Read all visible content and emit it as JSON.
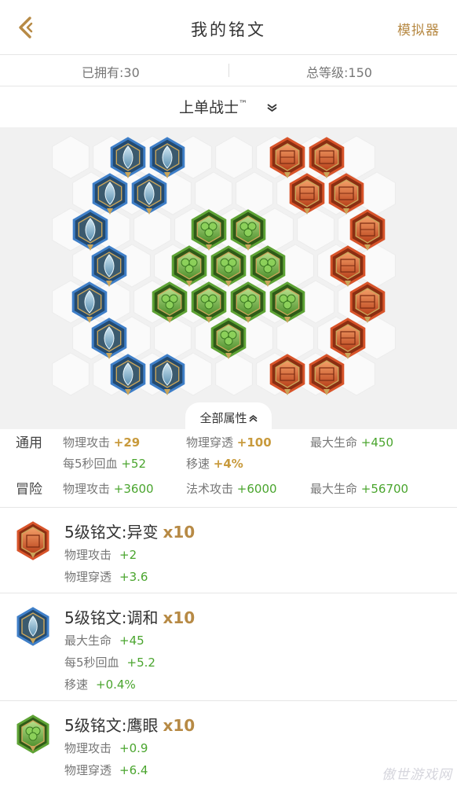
{
  "header": {
    "title": "我的铭文",
    "simulator_label": "模拟器",
    "back_icon": "back-chevron-icon",
    "accent_color": "#b78a45"
  },
  "stats": {
    "owned": "已拥有:30",
    "total_level": "总等级:150"
  },
  "page_selector": {
    "label": "上单战士",
    "trademark": "™"
  },
  "board": {
    "all_attributes_label": "全部属性",
    "blue_runes": 10,
    "green_runes": 10,
    "red_runes": 10,
    "colors": {
      "blue": "#3f7fc8",
      "green": "#5ea335",
      "red": "#d8542a",
      "empty_slot": "#fafafa"
    }
  },
  "attributes": {
    "general": {
      "label": "通用",
      "items": [
        {
          "name": "物理攻击",
          "value": "+29"
        },
        {
          "name": "物理穿透",
          "value": "+100"
        },
        {
          "name": "最大生命",
          "value": "+450"
        },
        {
          "name": "每5秒回血",
          "value": "+52"
        },
        {
          "name": "移速",
          "value": "+4%"
        }
      ]
    },
    "adventure": {
      "label": "冒险",
      "items": [
        {
          "name": "物理攻击",
          "value": "+3600"
        },
        {
          "name": "法术攻击",
          "value": "+6000"
        },
        {
          "name": "最大生命",
          "value": "+56700"
        }
      ]
    }
  },
  "runes": [
    {
      "name": "5级铭文:异变",
      "count": "x10",
      "color": "red",
      "stats": [
        {
          "name": "物理攻击",
          "value": "+2"
        },
        {
          "name": "物理穿透",
          "value": "+3.6"
        }
      ]
    },
    {
      "name": "5级铭文:调和",
      "count": "x10",
      "color": "blue",
      "stats": [
        {
          "name": "最大生命",
          "value": "+45"
        },
        {
          "name": "每5秒回血",
          "value": "+5.2"
        },
        {
          "name": "移速",
          "value": "+0.4%"
        }
      ]
    },
    {
      "name": "5级铭文:鹰眼",
      "count": "x10",
      "color": "green",
      "stats": [
        {
          "name": "物理攻击",
          "value": "+0.9"
        },
        {
          "name": "物理穿透",
          "value": "+6.4"
        }
      ]
    }
  ],
  "watermark": "傲世游戏网"
}
